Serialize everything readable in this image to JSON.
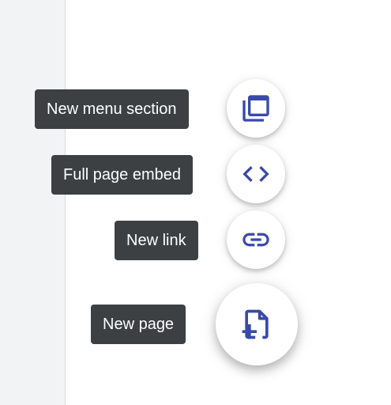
{
  "theme": {
    "icon_color": "#3949ab",
    "tooltip_bg": "#3c4043",
    "tooltip_text": "#ffffff",
    "sidebar_bg": "#f1f3f4"
  },
  "menu": {
    "items": [
      {
        "label": "New menu section",
        "icon": "new-menu-section-icon"
      },
      {
        "label": "Full page embed",
        "icon": "code-icon"
      },
      {
        "label": "New link",
        "icon": "link-icon"
      },
      {
        "label": "New page",
        "icon": "new-page-icon"
      }
    ]
  }
}
